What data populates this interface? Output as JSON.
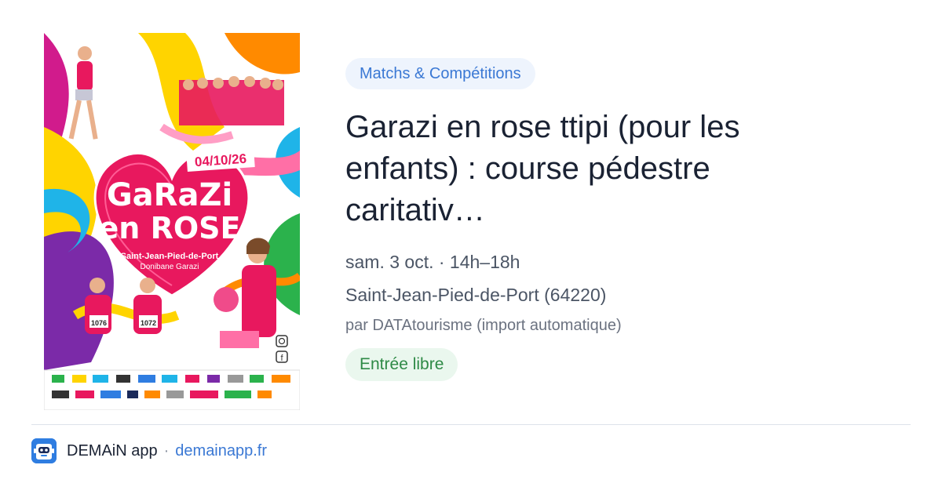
{
  "poster": {
    "date": "04/10/26",
    "title_line1": "GaRaZi",
    "title_line2": "en ROSE",
    "place": "Saint-Jean-Pied-de-Port",
    "place_basque": "Donibane Garazi",
    "bib1": "1076",
    "bib2": "1072"
  },
  "event": {
    "category": "Matchs & Compétitions",
    "title": "Garazi en rose ttipi (pour les enfants) : course pédestre caritativ…",
    "date_time": "sam. 3 oct. · 14h–18h",
    "location": "Saint-Jean-Pied-de-Port (64220)",
    "source": "par DATAtourisme (import automatique)",
    "price": "Entrée libre"
  },
  "footer": {
    "app_name": "DEMAiN app",
    "separator": "·",
    "url": "demainapp.fr",
    "logo_icon": "robot-face-icon"
  },
  "colors": {
    "accent_blue": "#3a78d4",
    "chip_bg": "#eef4fd",
    "price_green": "#2e8a46",
    "price_bg": "#eaf7ee",
    "poster_pink": "#e8185e"
  }
}
